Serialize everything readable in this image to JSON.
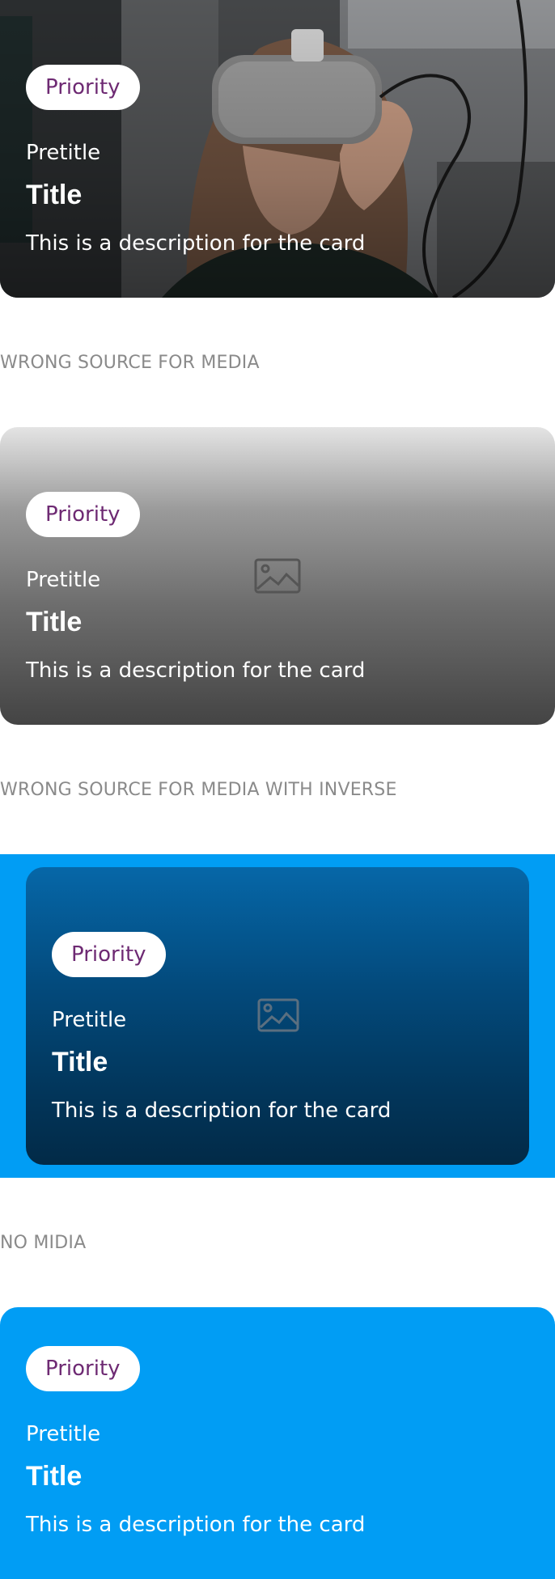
{
  "colors": {
    "brand_blue": "#019df4",
    "badge_text": "#6e2a73",
    "section_label": "#8a8a8a"
  },
  "cards": [
    {
      "badge": "Priority",
      "pretitle": "Pretitle",
      "title": "Title",
      "description": "This is a description for the card",
      "media": "vr-headset-photo"
    },
    {
      "badge": "Priority",
      "pretitle": "Pretitle",
      "title": "Title",
      "description": "This is a description for the card",
      "media": "image-placeholder-icon"
    },
    {
      "badge": "Priority",
      "pretitle": "Pretitle",
      "title": "Title",
      "description": "This is a description for the card",
      "media": "image-placeholder-icon"
    },
    {
      "badge": "Priority",
      "pretitle": "Pretitle",
      "title": "Title",
      "description": "This is a description for the card"
    }
  ],
  "sections": {
    "wrong_source": "WRONG SOURCE FOR MEDIA",
    "wrong_source_inverse": "WRONG SOURCE FOR MEDIA WITH INVERSE",
    "no_media": "NO MIDIA"
  }
}
